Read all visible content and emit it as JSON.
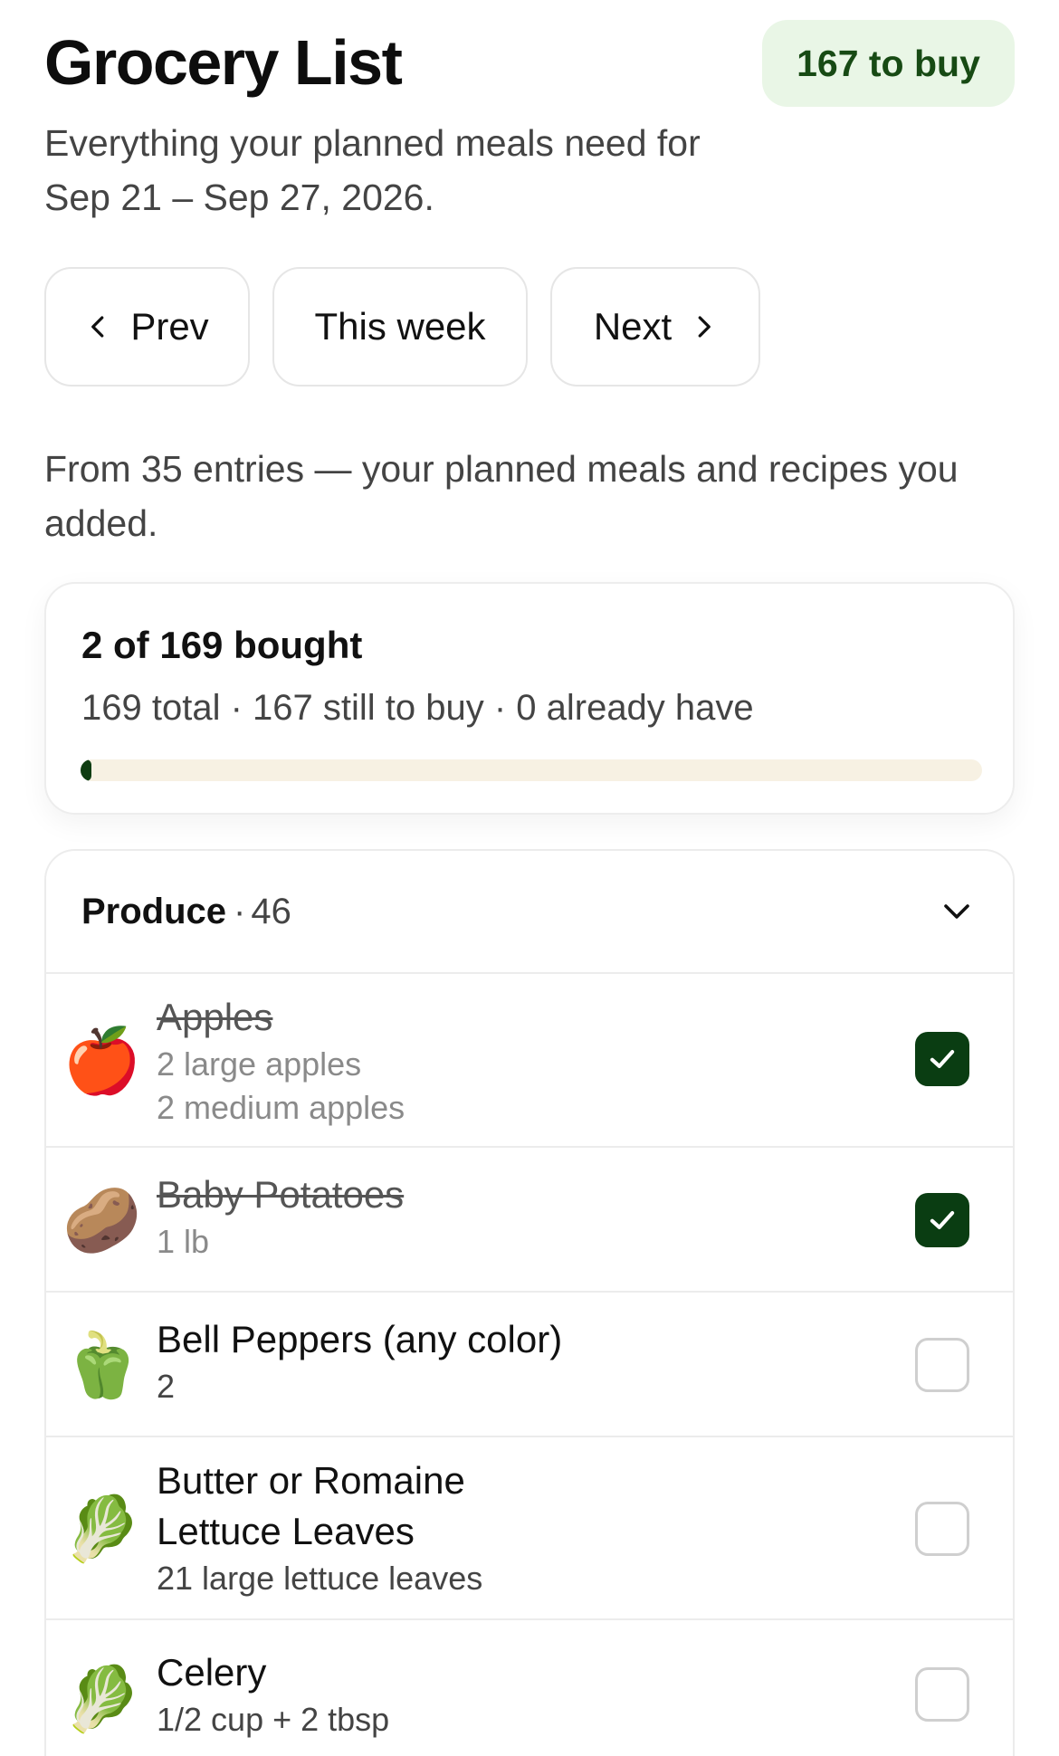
{
  "header": {
    "title": "Grocery List",
    "to_buy_badge": "167 to buy",
    "subtitle": "Everything your planned meals need for Sep 21 – Sep 27, 2026."
  },
  "week_nav": {
    "prev_label": "Prev",
    "this_week_label": "This week",
    "next_label": "Next"
  },
  "entries_note": "From 35 entries — your planned meals and recipes you added.",
  "summary": {
    "title": "2 of 169 bought",
    "stats": "169 total · 167 still to buy · 0 already have",
    "progress_fraction": 0.0118
  },
  "category": {
    "name": "Produce",
    "dot": "·",
    "count": "46",
    "items": [
      {
        "emoji": "🍎",
        "emoji_name": "apple-icon",
        "name": "Apples",
        "quantities": [
          "2 large apples",
          "2 medium apples"
        ],
        "checked": true
      },
      {
        "emoji": "🥔",
        "emoji_name": "potato-icon",
        "name": "Baby Potatoes",
        "quantities": [
          "1 lb"
        ],
        "checked": true
      },
      {
        "emoji": "🫑",
        "emoji_name": "bell-pepper-icon",
        "name": "Bell Peppers (any color)",
        "quantities": [
          "2"
        ],
        "checked": false
      },
      {
        "emoji": "🥬",
        "emoji_name": "lettuce-icon",
        "name_lines": [
          "Butter or Romaine",
          "Lettuce Leaves"
        ],
        "quantities": [
          "21 large lettuce leaves"
        ],
        "checked": false
      },
      {
        "emoji": "🥬",
        "emoji_name": "celery-icon",
        "name": "Celery",
        "quantities": [
          "1/2 cup + 2 tbsp"
        ],
        "checked": false
      }
    ]
  },
  "colors": {
    "accent_dark_green": "#0a3d12",
    "badge_bg": "#e9f6e6",
    "badge_text": "#174a14",
    "progress_track": "#f7f1e3"
  }
}
